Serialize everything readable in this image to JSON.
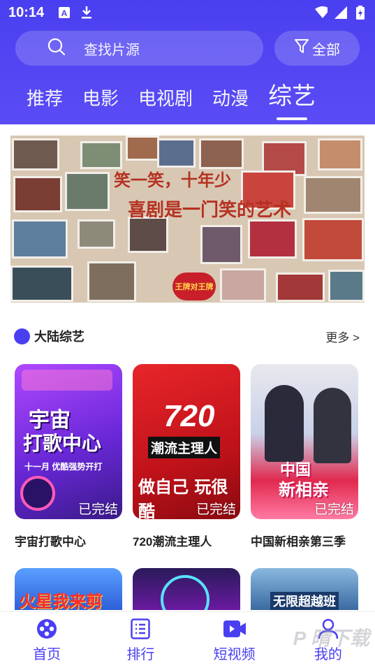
{
  "status_bar": {
    "time": "10:14"
  },
  "search": {
    "placeholder": "查找片源",
    "filter_label": "全部"
  },
  "tabs": [
    {
      "label": "推荐"
    },
    {
      "label": "电影"
    },
    {
      "label": "电视剧"
    },
    {
      "label": "动漫"
    },
    {
      "label": "综艺",
      "active": true
    }
  ],
  "banner": {
    "line1": "笑一笑，十年少",
    "line2": "喜剧是一门笑的艺术",
    "logo_text": "王牌对王牌"
  },
  "section": {
    "title": "大陆综艺",
    "more_label": "更多 >"
  },
  "cards": [
    {
      "title": "宇宙打歌中心",
      "badge": "已完结",
      "poster_line1": "宇宙",
      "poster_line2": "打歌中心",
      "poster_sub": "十一月 优酷强势开打"
    },
    {
      "title": "720潮流主理人",
      "badge": "已完结",
      "poster_line1": "720",
      "poster_line2": "潮流主理人",
      "poster_sub": "做自己 玩很酷"
    },
    {
      "title": "中国新相亲第三季",
      "badge": "已完结",
      "poster_line1": "中国",
      "poster_line2": "新相亲"
    }
  ],
  "partial_cards": [
    {
      "poster_text": "火星我来剪"
    },
    {
      "poster_text": ""
    },
    {
      "poster_text": "无限超越班"
    }
  ],
  "bottom_nav": [
    {
      "label": "首页",
      "icon": "film-reel-icon"
    },
    {
      "label": "排行",
      "icon": "list-icon"
    },
    {
      "label": "短视频",
      "icon": "video-camera-icon"
    },
    {
      "label": "我的",
      "icon": "user-icon"
    }
  ],
  "colors": {
    "accent": "#4a3ff0"
  }
}
